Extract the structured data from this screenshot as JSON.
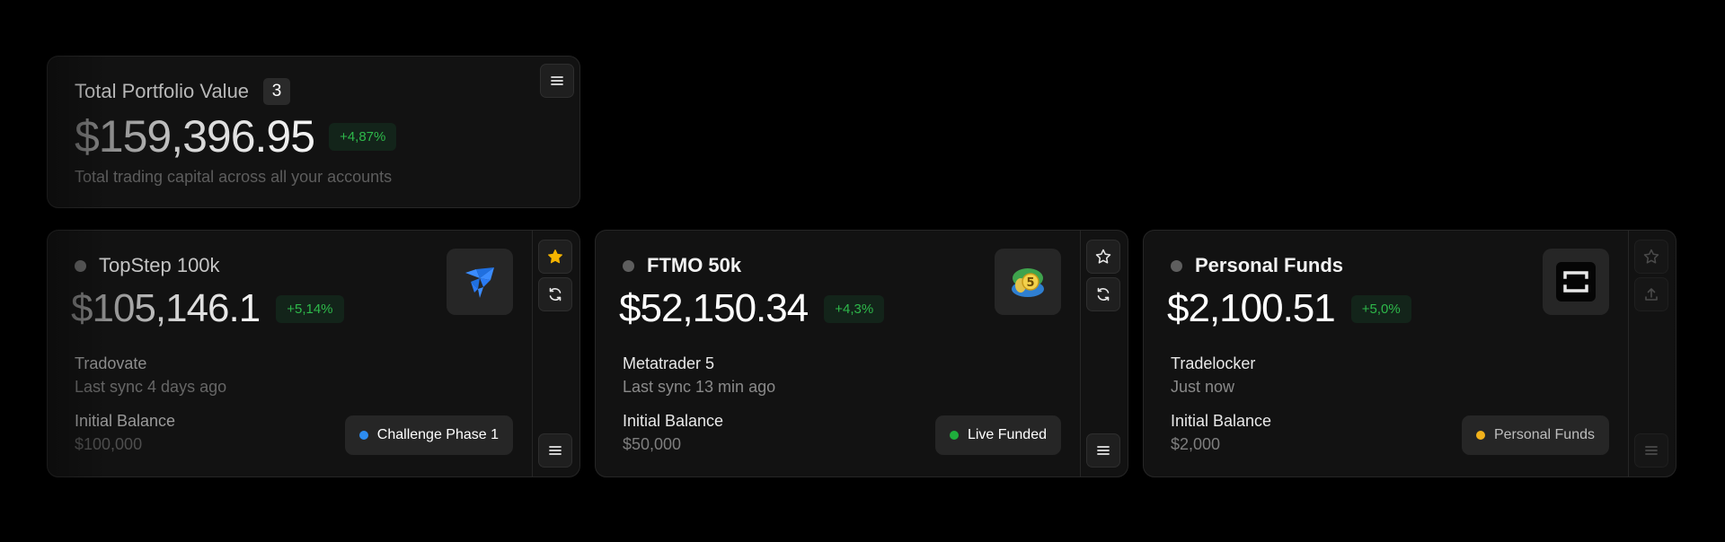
{
  "summary": {
    "title": "Total Portfolio Value",
    "account_count": "3",
    "value": "$159,396.95",
    "change": "+4,87%",
    "subtitle": "Total trading capital across all your accounts",
    "menu_icon": "menu-icon"
  },
  "accounts": [
    {
      "name": "TopStep 100k",
      "value": "$105,146.1",
      "change": "+5,14%",
      "platform": "Tradovate",
      "sync": "Last sync 4 days ago",
      "balance_label": "Initial Balance",
      "balance_value": "$100,000",
      "tag": "Challenge Phase 1",
      "tag_color": "#2d8cf0",
      "logo": "tradovate-logo",
      "favorite": true,
      "actions": [
        "star-icon",
        "sync-icon",
        "menu-icon"
      ]
    },
    {
      "name": "FTMO 50k",
      "value": "$52,150.34",
      "change": "+4,3%",
      "platform": "Metatrader 5",
      "sync": "Last sync 13 min ago",
      "balance_label": "Initial Balance",
      "balance_value": "$50,000",
      "tag": "Live Funded",
      "tag_color": "#1fae3c",
      "logo": "metatrader5-logo",
      "favorite": false,
      "actions": [
        "star-icon",
        "sync-icon",
        "menu-icon"
      ]
    },
    {
      "name": "Personal Funds",
      "value": "$2,100.51",
      "change": "+5,0%",
      "platform": "Tradelocker",
      "sync": "Just now",
      "balance_label": "Initial Balance",
      "balance_value": "$2,000",
      "tag": "Personal Funds",
      "tag_color": "#f2b21b",
      "logo": "tradelocker-logo",
      "favorite": false,
      "actions": [
        "star-icon",
        "upload-icon",
        "menu-icon"
      ]
    }
  ],
  "colors": {
    "background": "#000000",
    "card": "#121212",
    "positive": "#2eb84a",
    "star_active": "#f5b400"
  }
}
